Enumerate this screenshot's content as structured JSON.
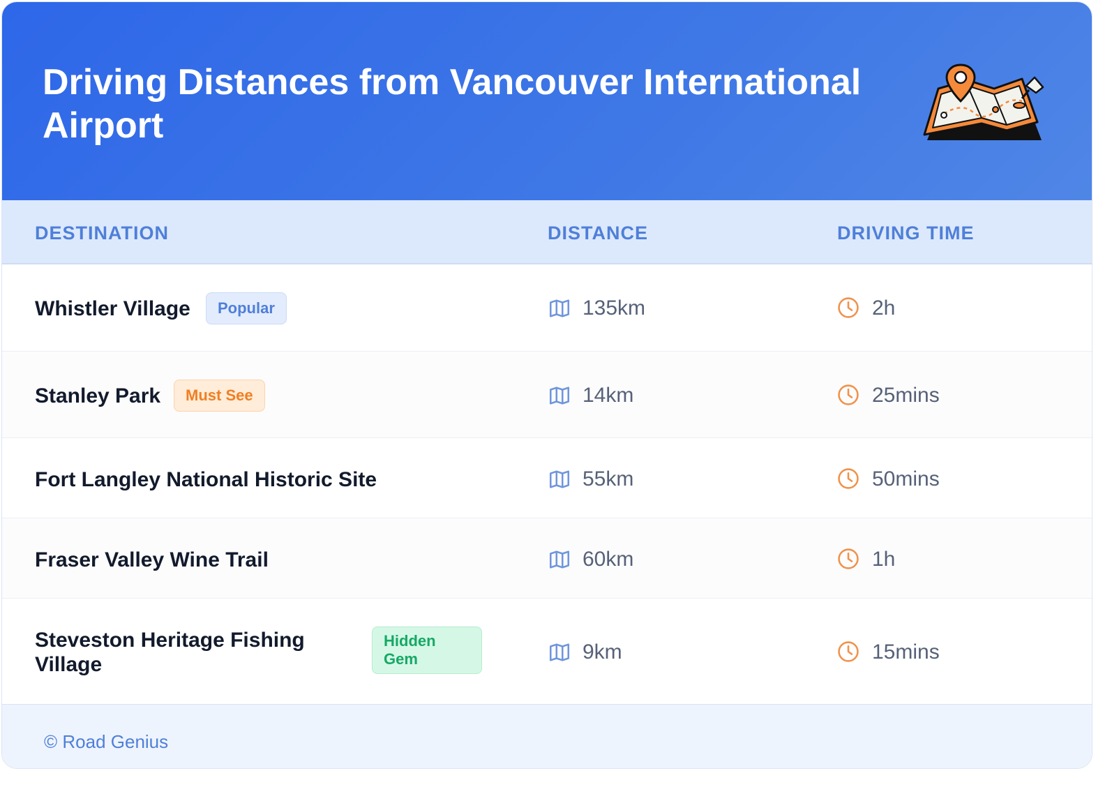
{
  "header": {
    "title": "Driving Distances from Vancouver International Airport",
    "illustration": "folded-map-with-location-pin-icon"
  },
  "table": {
    "columns": [
      "DESTINATION",
      "DISTANCE",
      "DRIVING TIME"
    ],
    "rows": [
      {
        "destination": "Whistler Village",
        "badge": "Popular",
        "badge_color": "#4f7fd8",
        "distance": "135km",
        "time": "2h"
      },
      {
        "destination": "Stanley Park",
        "badge": "Must See",
        "badge_color": "#f07f22",
        "distance": "14km",
        "time": "25mins"
      },
      {
        "destination": "Fort Langley National Historic Site",
        "badge": "",
        "distance": "55km",
        "time": "50mins"
      },
      {
        "destination": "Fraser Valley Wine Trail",
        "badge": "",
        "distance": "60km",
        "time": "1h"
      },
      {
        "destination": "Steveston Heritage Fishing Village",
        "badge": "Hidden Gem",
        "badge_color": "#17a866",
        "distance": "9km",
        "time": "15mins"
      }
    ],
    "distance_icon": "map-icon",
    "time_icon": "clock-icon",
    "distance_icon_color": "#6f96dc",
    "time_icon_color": "#f0924a"
  },
  "footer": {
    "credit": "© Road Genius"
  },
  "colors": {
    "header_bg": "#2e67e8",
    "accent_blue": "#4f7fd8",
    "table_header_bg": "#dce9fd"
  }
}
